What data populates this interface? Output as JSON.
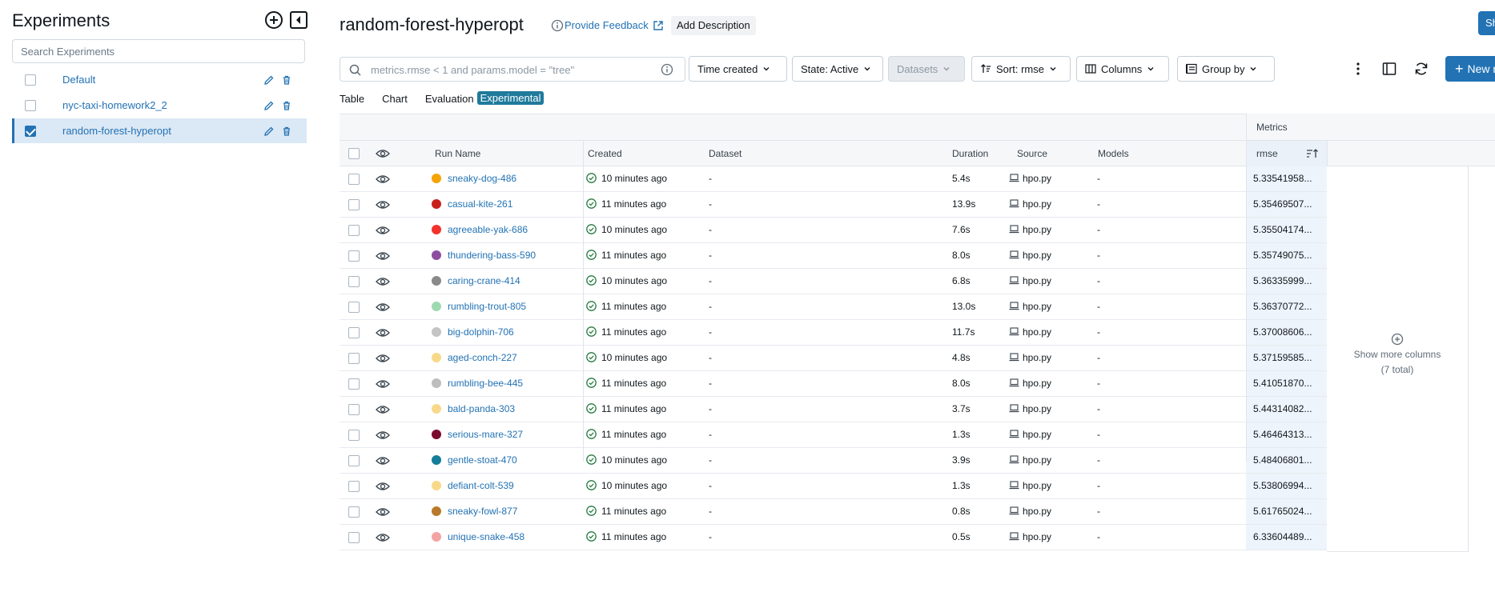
{
  "sidebar": {
    "title": "Experiments",
    "search_placeholder": "Search Experiments",
    "experiments": [
      {
        "name": "Default",
        "checked": false,
        "selected": false
      },
      {
        "name": "nyc-taxi-homework2_2",
        "checked": false,
        "selected": false
      },
      {
        "name": "random-forest-hyperopt",
        "checked": true,
        "selected": true
      }
    ]
  },
  "header": {
    "title": "random-forest-hyperopt",
    "feedback_label": "Provide Feedback",
    "add_description_label": "Add Description",
    "share_label": "Sha",
    "new_run_label": "New r"
  },
  "toolbar": {
    "search_placeholder": "metrics.rmse < 1 and params.model = \"tree\"",
    "time_created_label": "Time created",
    "state_label": "State: Active",
    "datasets_label": "Datasets",
    "sort_label": "Sort: rmse",
    "columns_label": "Columns",
    "group_by_label": "Group by"
  },
  "tabs": {
    "table": "Table",
    "chart": "Chart",
    "evaluation": "Evaluation",
    "experimental_badge": "Experimental"
  },
  "table": {
    "metrics_group_label": "Metrics",
    "headers": {
      "run_name": "Run Name",
      "created": "Created",
      "dataset": "Dataset",
      "duration": "Duration",
      "source": "Source",
      "models": "Models",
      "rmse": "rmse"
    },
    "show_more_columns": "Show more columns",
    "show_more_total": "(7 total)",
    "rows": [
      {
        "name": "sneaky-dog-486",
        "color": "#f5a300",
        "created": "10 minutes ago",
        "dataset": "-",
        "duration": "5.4s",
        "source": "hpo.py",
        "models": "-",
        "rmse": "5.33541958..."
      },
      {
        "name": "casual-kite-261",
        "color": "#c8201c",
        "created": "11 minutes ago",
        "dataset": "-",
        "duration": "13.9s",
        "source": "hpo.py",
        "models": "-",
        "rmse": "5.35469507..."
      },
      {
        "name": "agreeable-yak-686",
        "color": "#f2322b",
        "created": "10 minutes ago",
        "dataset": "-",
        "duration": "7.6s",
        "source": "hpo.py",
        "models": "-",
        "rmse": "5.35504174..."
      },
      {
        "name": "thundering-bass-590",
        "color": "#8e4ea0",
        "created": "11 minutes ago",
        "dataset": "-",
        "duration": "8.0s",
        "source": "hpo.py",
        "models": "-",
        "rmse": "5.35749075..."
      },
      {
        "name": "caring-crane-414",
        "color": "#8a8a8a",
        "created": "10 minutes ago",
        "dataset": "-",
        "duration": "6.8s",
        "source": "hpo.py",
        "models": "-",
        "rmse": "5.36335999..."
      },
      {
        "name": "rumbling-trout-805",
        "color": "#9ed9b0",
        "created": "11 minutes ago",
        "dataset": "-",
        "duration": "13.0s",
        "source": "hpo.py",
        "models": "-",
        "rmse": "5.36370772..."
      },
      {
        "name": "big-dolphin-706",
        "color": "#c4c4c4",
        "created": "11 minutes ago",
        "dataset": "-",
        "duration": "11.7s",
        "source": "hpo.py",
        "models": "-",
        "rmse": "5.37008606..."
      },
      {
        "name": "aged-conch-227",
        "color": "#f8d98a",
        "created": "10 minutes ago",
        "dataset": "-",
        "duration": "4.8s",
        "source": "hpo.py",
        "models": "-",
        "rmse": "5.37159585..."
      },
      {
        "name": "rumbling-bee-445",
        "color": "#bdbdbd",
        "created": "11 minutes ago",
        "dataset": "-",
        "duration": "8.0s",
        "source": "hpo.py",
        "models": "-",
        "rmse": "5.41051870..."
      },
      {
        "name": "bald-panda-303",
        "color": "#f8d98a",
        "created": "11 minutes ago",
        "dataset": "-",
        "duration": "3.7s",
        "source": "hpo.py",
        "models": "-",
        "rmse": "5.44314082..."
      },
      {
        "name": "serious-mare-327",
        "color": "#7a0a2e",
        "created": "11 minutes ago",
        "dataset": "-",
        "duration": "1.3s",
        "source": "hpo.py",
        "models": "-",
        "rmse": "5.46464313..."
      },
      {
        "name": "gentle-stoat-470",
        "color": "#147d99",
        "created": "10 minutes ago",
        "dataset": "-",
        "duration": "3.9s",
        "source": "hpo.py",
        "models": "-",
        "rmse": "5.48406801..."
      },
      {
        "name": "defiant-colt-539",
        "color": "#f8d98a",
        "created": "10 minutes ago",
        "dataset": "-",
        "duration": "1.3s",
        "source": "hpo.py",
        "models": "-",
        "rmse": "5.53806994..."
      },
      {
        "name": "sneaky-fowl-877",
        "color": "#b87a2a",
        "created": "11 minutes ago",
        "dataset": "-",
        "duration": "0.8s",
        "source": "hpo.py",
        "models": "-",
        "rmse": "5.61765024..."
      },
      {
        "name": "unique-snake-458",
        "color": "#f3a3a3",
        "created": "11 minutes ago",
        "dataset": "-",
        "duration": "0.5s",
        "source": "hpo.py",
        "models": "-",
        "rmse": "6.33604489..."
      }
    ]
  }
}
